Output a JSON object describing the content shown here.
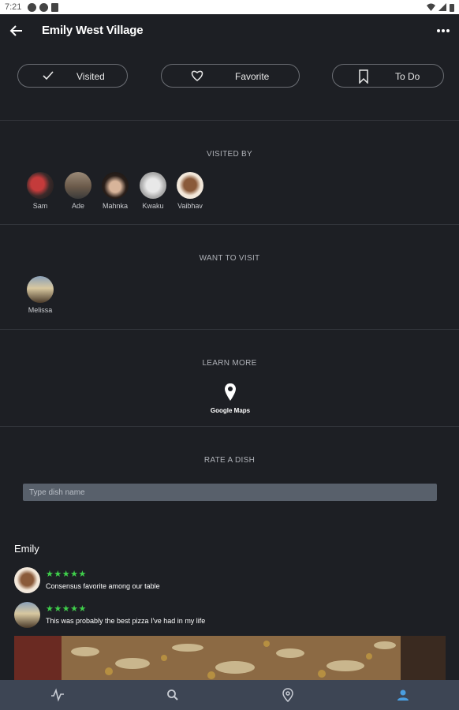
{
  "status_bar": {
    "time": "7:21"
  },
  "header": {
    "title": "Emily West Village"
  },
  "actions": [
    {
      "label": "Visited",
      "icon": "check-icon"
    },
    {
      "label": "Favorite",
      "icon": "heart-icon"
    },
    {
      "label": "To Do",
      "icon": "bookmark-icon"
    }
  ],
  "visited_by": {
    "title": "VISITED BY",
    "people": [
      {
        "name": "Sam"
      },
      {
        "name": "Ade"
      },
      {
        "name": "Mahnka"
      },
      {
        "name": "Kwaku"
      },
      {
        "name": "Vaibhav"
      }
    ]
  },
  "want_to_visit": {
    "title": "WANT TO VISIT",
    "people": [
      {
        "name": "Melissa"
      }
    ]
  },
  "learn_more": {
    "title": "LEARN MORE",
    "link_label": "Google Maps",
    "icon": "map-pin-icon"
  },
  "rate_dish": {
    "title": "RATE A DISH",
    "placeholder": "Type dish name"
  },
  "reviews": {
    "dish_name": "Emily",
    "items": [
      {
        "stars": "★★★★★",
        "rating": 4.5,
        "text": "Consensus favorite among our table"
      },
      {
        "stars": "★★★★★",
        "rating": 5,
        "text": "This was probably the best pizza I've had in my life"
      }
    ]
  },
  "colors": {
    "accent": "#4a9ee0",
    "star": "#3fcf4b",
    "background": "#1d1f24",
    "nav": "#3d4554"
  },
  "bottom_nav": [
    {
      "icon": "activity-icon"
    },
    {
      "icon": "search-icon"
    },
    {
      "icon": "location-icon"
    },
    {
      "icon": "profile-icon",
      "active": true
    }
  ]
}
